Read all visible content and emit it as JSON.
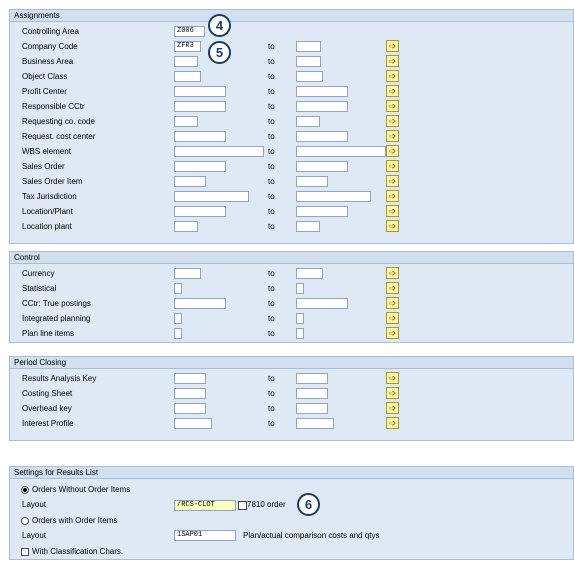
{
  "assignments": {
    "title": "Assignments",
    "rows": [
      {
        "label": "Controlling Area",
        "from": "Z006",
        "to": null
      },
      {
        "label": "Company Code",
        "from": "ZFR3",
        "to": ""
      },
      {
        "label": "Business Area",
        "from": "",
        "to": ""
      },
      {
        "label": "Object Class",
        "from": "",
        "to": ""
      },
      {
        "label": "Profit Center",
        "from": "",
        "to": ""
      },
      {
        "label": "Responsible CCtr",
        "from": "",
        "to": ""
      },
      {
        "label": "Requesting co. code",
        "from": "",
        "to": ""
      },
      {
        "label": "Request. cost center",
        "from": "",
        "to": ""
      },
      {
        "label": "WBS element",
        "from": "",
        "to": ""
      },
      {
        "label": "Sales Order",
        "from": "",
        "to": ""
      },
      {
        "label": "Sales Order Item",
        "from": "",
        "to": ""
      },
      {
        "label": "Tax Jurisdiction",
        "from": "",
        "to": ""
      },
      {
        "label": "Location/Plant",
        "from": "",
        "to": ""
      },
      {
        "label": "Location plant",
        "from": "",
        "to": ""
      }
    ]
  },
  "control": {
    "title": "Control",
    "rows": [
      {
        "label": "Currency",
        "from": "",
        "to": ""
      },
      {
        "label": "Statistical",
        "from": "",
        "to": ""
      },
      {
        "label": "CCtr: True postings",
        "from": "",
        "to": ""
      },
      {
        "label": "Integrated planning",
        "from": "",
        "to": ""
      },
      {
        "label": "Plan line items",
        "from": "",
        "to": ""
      }
    ]
  },
  "period_closing": {
    "title": "Period Closing",
    "rows": [
      {
        "label": "Results Analysis Key",
        "from": "",
        "to": ""
      },
      {
        "label": "Costing Sheet",
        "from": "",
        "to": ""
      },
      {
        "label": "Overhead key",
        "from": "",
        "to": ""
      },
      {
        "label": "Interest Profile",
        "from": "",
        "to": ""
      }
    ]
  },
  "to_label": "to",
  "more_icon": "yellow-arrow-icon",
  "results": {
    "title": "Settings for Results List",
    "radio1": "Orders Without Order Items",
    "layout_label": "Layout",
    "layout1_value": "/RCS-CLOT",
    "layout1_desc": "7810 order",
    "radio2": "Orders with Order Items",
    "layout2_value": "1SAP01",
    "layout2_desc": "Plan/actual comparison costs and qtys",
    "checkbox": "With Classification Chars."
  },
  "badges": [
    "4",
    "5",
    "6"
  ]
}
